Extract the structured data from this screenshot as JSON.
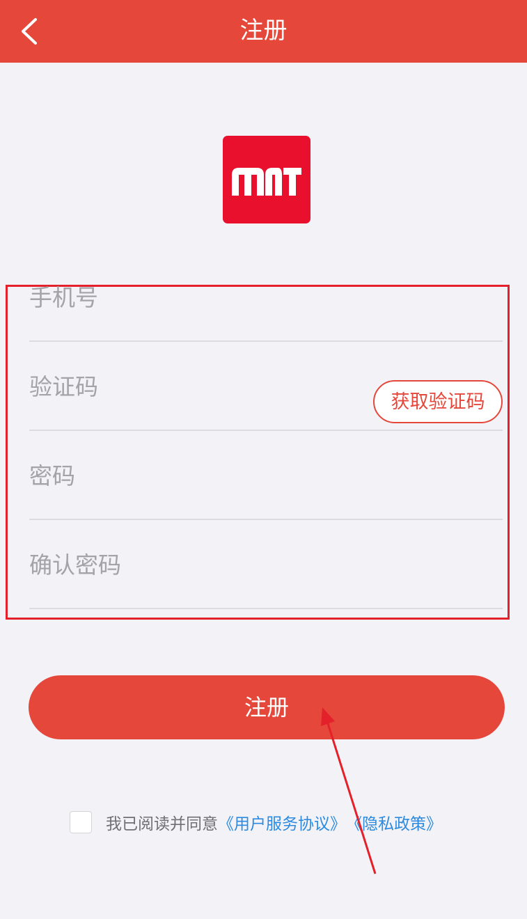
{
  "header": {
    "title": "注册",
    "back_icon": "chevron-left-icon"
  },
  "logo": {
    "text": "mT",
    "color": "#e8102d"
  },
  "form": {
    "phone_placeholder": "手机号",
    "code_placeholder": "验证码",
    "get_code_label": "获取验证码",
    "password_placeholder": "密码",
    "confirm_password_placeholder": "确认密码"
  },
  "register_button_label": "注册",
  "agreement": {
    "prefix": "我已阅读并同意",
    "terms_link": "《用户服务协议》",
    "privacy_link": "《隐私政策》"
  },
  "colors": {
    "accent": "#e5473a",
    "highlight_border": "#e4202a",
    "link": "#2c8ae0"
  }
}
